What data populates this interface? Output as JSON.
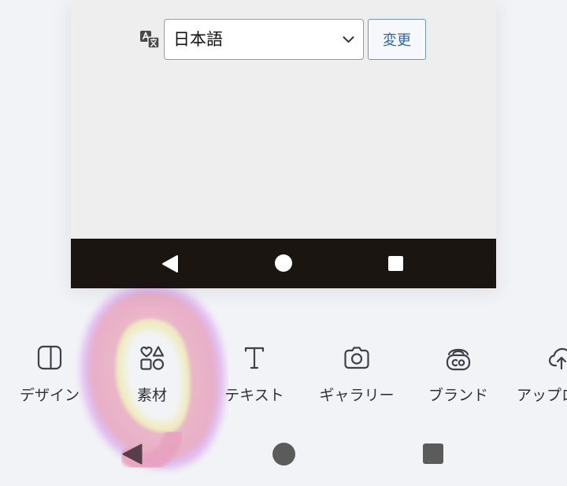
{
  "preview": {
    "translate_icon": "translate-icon",
    "language_select": {
      "value": "日本語",
      "chevron_icon": "chevron-down-icon"
    },
    "change_button": {
      "label": "変更"
    },
    "nav_bar": {
      "back_icon": "back-triangle-icon",
      "home_icon": "home-circle-icon",
      "recents_icon": "recents-square-icon"
    }
  },
  "toolbar": {
    "items": [
      {
        "label": "デザイン",
        "icon": "design-layout-icon"
      },
      {
        "label": "素材",
        "icon": "elements-shapes-icon"
      },
      {
        "label": "テキスト",
        "icon": "text-t-icon"
      },
      {
        "label": "ギャラリー",
        "icon": "camera-icon"
      },
      {
        "label": "ブランド",
        "icon": "brand-kit-icon"
      },
      {
        "label": "アップロ",
        "icon": "upload-cloud-icon"
      }
    ]
  },
  "system_nav": {
    "back_icon": "back-triangle-icon",
    "home_icon": "home-circle-icon",
    "recents_icon": "recents-square-icon"
  },
  "colors": {
    "page_background": "#f2f3f7",
    "preview_background": "#eeeeee",
    "nav_bar": "#1b1512",
    "button_border": "#6f95c2",
    "button_background": "#f6f8fb",
    "button_text": "#2c68a8",
    "icon": "#3d4148",
    "label": "#2f3237",
    "system_nav": "#5b5b5b",
    "highlight_pink": "#f6b9cc",
    "highlight_lavender": "#e9b3f2",
    "highlight_yellow": "#fbf5b0"
  }
}
